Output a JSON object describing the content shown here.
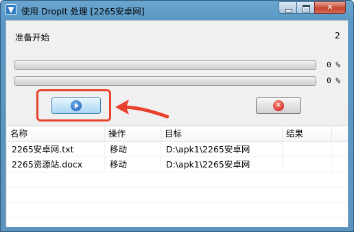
{
  "window": {
    "title": "使用 DropIt 处理 [2265安卓网]",
    "app_icon_glyph": "▼",
    "controls": {
      "minimize": "minimize-icon",
      "maximize": "maximize-icon",
      "close": "close-icon",
      "close_glyph": "✕"
    }
  },
  "status": {
    "text": "准备开始",
    "count": "2"
  },
  "progress": [
    {
      "label": "0 %",
      "fraction": 0
    },
    {
      "label": "0 %",
      "fraction": 0
    }
  ],
  "buttons": {
    "start_icon": "play-icon",
    "cancel_icon": "cancel-icon",
    "cancel_glyph": "✕"
  },
  "annotation": {
    "color": "#e8412c"
  },
  "list": {
    "columns": [
      "名称",
      "操作",
      "目标",
      "结果"
    ],
    "rows": [
      {
        "name": "2265安卓网.txt",
        "action": "移动",
        "target": "D:\\apk1\\2265安卓网",
        "result": ""
      },
      {
        "name": "2265资源站.docx",
        "action": "移动",
        "target": "D:\\apk1\\2265安卓网",
        "result": ""
      }
    ]
  }
}
